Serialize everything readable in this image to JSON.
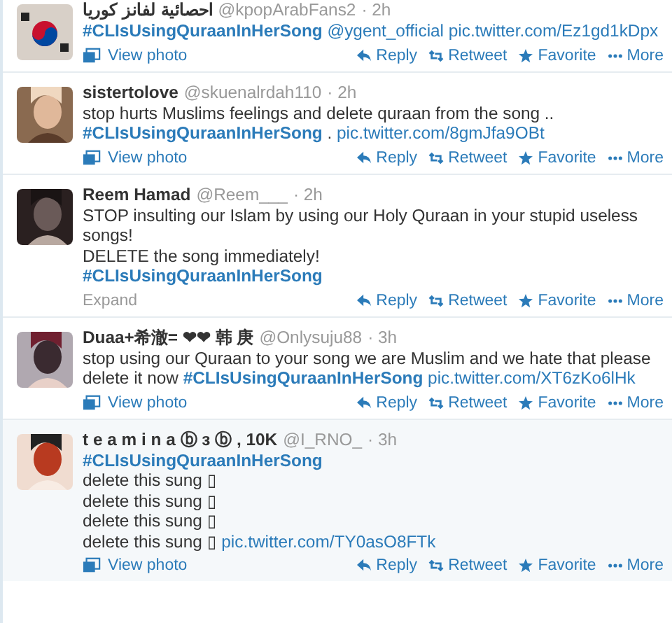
{
  "tweets": [
    {
      "name": "احصائية لفانز كوريا",
      "handle": "@kpopArabFans2",
      "time": "· 2h",
      "lines": [
        [
          {
            "kind": "hashtag",
            "text": "#CLIsUsingQuraanInHerSong"
          },
          {
            "kind": "link",
            "text": "@ygent_official"
          },
          {
            "kind": "link",
            "text": "pic.twitter.com/Ez1gd1kDpx"
          }
        ]
      ],
      "media": "View photo",
      "actions": [
        "Reply",
        "Retweet",
        "Favorite",
        "More"
      ]
    },
    {
      "name": "sistertolove",
      "handle": "@skuenalrdah110",
      "time": "· 2h",
      "lines": [
        [
          {
            "kind": "text",
            "text": "stop hurts Muslims feelings and delete quraan from the song  .."
          }
        ],
        [
          {
            "kind": "hashtag",
            "text": "#CLIsUsingQuraanInHerSong"
          },
          {
            "kind": "text",
            "text": "."
          },
          {
            "kind": "link",
            "text": "pic.twitter.com/8gmJfa9OBt"
          }
        ]
      ],
      "media": "View photo",
      "actions": [
        "Reply",
        "Retweet",
        "Favorite",
        "More"
      ]
    },
    {
      "name": "Reem Hamad",
      "handle": "@Reem___",
      "time": "· 2h",
      "lines": [
        [
          {
            "kind": "text",
            "text": "STOP insulting our Islam by using our Holy Quraan in your stupid useless songs!"
          }
        ],
        [
          {
            "kind": "text",
            "text": "DELETE the song immediately!"
          }
        ],
        [
          {
            "kind": "hashtag",
            "text": "#CLIsUsingQuraanInHerSong"
          }
        ]
      ],
      "expand": "Expand",
      "actions": [
        "Reply",
        "Retweet",
        "Favorite",
        "More"
      ]
    },
    {
      "name": "Duaa+希澈= ❤❤ 韩 庚",
      "handle": "@Onlysuju88",
      "time": "· 3h",
      "lines": [
        [
          {
            "kind": "text",
            "text": "stop using our Quraan to your song we are Muslim and we hate that please delete it now"
          },
          {
            "kind": "hashtag",
            "text": "#CLIsUsingQuraanInHerSong"
          },
          {
            "kind": "link",
            "text": "pic.twitter.com/XT6zKo6lHk"
          }
        ]
      ],
      "media": "View photo",
      "actions": [
        "Reply",
        "Retweet",
        "Favorite",
        "More"
      ]
    },
    {
      "name": "t e a m i n a ⓑ ɜ ⓑ , 10K",
      "handle": "@I_RNO_",
      "time": "· 3h",
      "lines": [
        [
          {
            "kind": "hashtag",
            "text": "#CLIsUsingQuraanInHerSong"
          }
        ],
        [
          {
            "kind": "text",
            "text": "delete this sung ▯"
          }
        ],
        [
          {
            "kind": "text",
            "text": "delete this sung ▯"
          }
        ],
        [
          {
            "kind": "text",
            "text": "delete this sung ▯"
          }
        ],
        [
          {
            "kind": "text",
            "text": "delete this sung ▯"
          },
          {
            "kind": "link",
            "text": "pic.twitter.com/TY0asO8FTk"
          }
        ]
      ],
      "media": "View photo",
      "actions": [
        "Reply",
        "Retweet",
        "Favorite",
        "More"
      ]
    }
  ]
}
